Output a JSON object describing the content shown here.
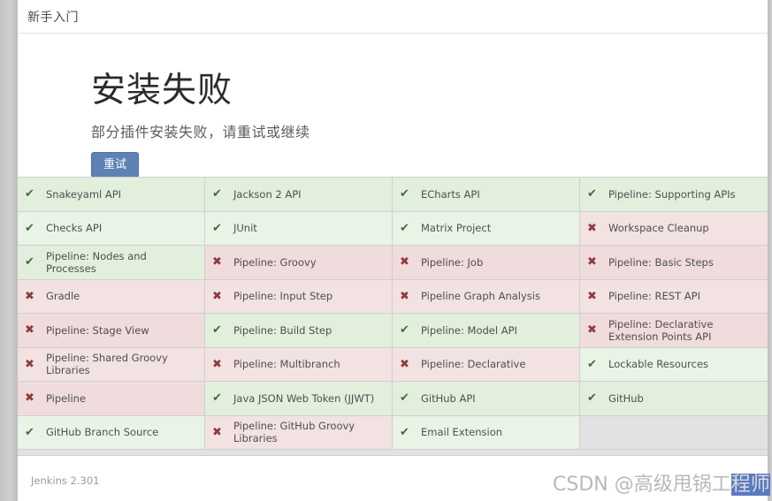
{
  "breadcrumb": {
    "items": [
      "新手入门"
    ]
  },
  "hero": {
    "title": "安装失败",
    "subtitle": "部分插件安装失败，请重试或继续",
    "retry_label": "重试"
  },
  "icons": {
    "success": "✔",
    "failure": "✖"
  },
  "colors": {
    "success_bg": "#e2efdd",
    "success_bg_alt": "#eaf4e6",
    "failure_bg": "#f0dcdc",
    "failure_bg_alt": "#f3e2e2",
    "success_icon": "#3f6b38",
    "failure_icon": "#8e3b3b",
    "empty_bg": "#e2e2e2",
    "button_bg": "#5f82b4"
  },
  "plugins": {
    "columns": [
      [
        {
          "name": "Snakeyaml API",
          "status": "ok"
        },
        {
          "name": "Checks API",
          "status": "ok"
        },
        {
          "name": "Pipeline: Nodes and Processes",
          "status": "ok"
        },
        {
          "name": "Gradle",
          "status": "fail"
        },
        {
          "name": "Pipeline: Stage View",
          "status": "fail"
        },
        {
          "name": "Pipeline: Shared Groovy Libraries",
          "status": "fail"
        },
        {
          "name": "Pipeline",
          "status": "fail"
        },
        {
          "name": "GitHub Branch Source",
          "status": "ok"
        }
      ],
      [
        {
          "name": "Jackson 2 API",
          "status": "ok"
        },
        {
          "name": "JUnit",
          "status": "ok"
        },
        {
          "name": "Pipeline: Groovy",
          "status": "fail"
        },
        {
          "name": "Pipeline: Input Step",
          "status": "fail"
        },
        {
          "name": "Pipeline: Build Step",
          "status": "ok"
        },
        {
          "name": "Pipeline: Multibranch",
          "status": "fail"
        },
        {
          "name": "Java JSON Web Token (JJWT)",
          "status": "ok"
        },
        {
          "name": "Pipeline: GitHub Groovy Libraries",
          "status": "fail"
        }
      ],
      [
        {
          "name": "ECharts API",
          "status": "ok"
        },
        {
          "name": "Matrix Project",
          "status": "ok"
        },
        {
          "name": "Pipeline: Job",
          "status": "fail"
        },
        {
          "name": "Pipeline Graph Analysis",
          "status": "fail"
        },
        {
          "name": "Pipeline: Model API",
          "status": "ok"
        },
        {
          "name": "Pipeline: Declarative",
          "status": "fail"
        },
        {
          "name": "GitHub API",
          "status": "ok"
        },
        {
          "name": "Email Extension",
          "status": "ok"
        }
      ],
      [
        {
          "name": "Pipeline: Supporting APIs",
          "status": "ok"
        },
        {
          "name": "Workspace Cleanup",
          "status": "fail"
        },
        {
          "name": "Pipeline: Basic Steps",
          "status": "fail"
        },
        {
          "name": "Pipeline: REST API",
          "status": "fail"
        },
        {
          "name": "Pipeline: Declarative Extension Points API",
          "status": "fail"
        },
        {
          "name": "Lockable Resources",
          "status": "ok"
        },
        {
          "name": "GitHub",
          "status": "ok"
        },
        {
          "name": "",
          "status": "empty"
        }
      ]
    ]
  },
  "footer": {
    "version": "Jenkins 2.301"
  },
  "watermark": {
    "prefix": "CSDN @高级甩锅工",
    "selected": "程师"
  }
}
